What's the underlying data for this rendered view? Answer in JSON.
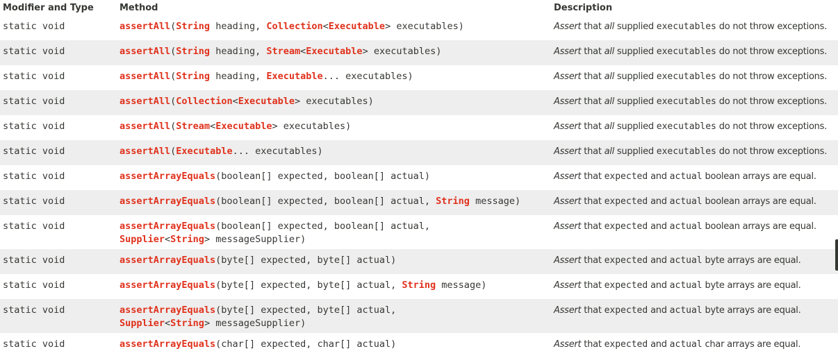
{
  "headers": {
    "modifier": "Modifier and Type",
    "method": "Method",
    "description": "Description"
  },
  "rows": [
    {
      "modifier": "static void",
      "name": "assertAll",
      "args": [
        "(",
        {
          "t": "String"
        },
        " heading, ",
        {
          "t": "Collection"
        },
        "<",
        {
          "t": "Executable"
        },
        "> executables)"
      ],
      "desc": [
        {
          "i": "Assert"
        },
        " that ",
        {
          "i": "all"
        },
        " supplied ",
        {
          "c": "executables"
        },
        " do not throw exceptions."
      ]
    },
    {
      "modifier": "static void",
      "name": "assertAll",
      "args": [
        "(",
        {
          "t": "String"
        },
        " heading, ",
        {
          "t": "Stream"
        },
        "<",
        {
          "t": "Executable"
        },
        "> executables)"
      ],
      "desc": [
        {
          "i": "Assert"
        },
        " that ",
        {
          "i": "all"
        },
        " supplied ",
        {
          "c": "executables"
        },
        " do not throw exceptions."
      ]
    },
    {
      "modifier": "static void",
      "name": "assertAll",
      "args": [
        "(",
        {
          "t": "String"
        },
        " heading, ",
        {
          "t": "Executable"
        },
        "... executables)"
      ],
      "desc": [
        {
          "i": "Assert"
        },
        " that ",
        {
          "i": "all"
        },
        " supplied ",
        {
          "c": "executables"
        },
        " do not throw exceptions."
      ]
    },
    {
      "modifier": "static void",
      "name": "assertAll",
      "args": [
        "(",
        {
          "t": "Collection"
        },
        "<",
        {
          "t": "Executable"
        },
        "> executables)"
      ],
      "desc": [
        {
          "i": "Assert"
        },
        " that ",
        {
          "i": "all"
        },
        " supplied ",
        {
          "c": "executables"
        },
        " do not throw exceptions."
      ]
    },
    {
      "modifier": "static void",
      "name": "assertAll",
      "args": [
        "(",
        {
          "t": "Stream"
        },
        "<",
        {
          "t": "Executable"
        },
        "> executables)"
      ],
      "desc": [
        {
          "i": "Assert"
        },
        " that ",
        {
          "i": "all"
        },
        " supplied ",
        {
          "c": "executables"
        },
        " do not throw exceptions."
      ]
    },
    {
      "modifier": "static void",
      "name": "assertAll",
      "args": [
        "(",
        {
          "t": "Executable"
        },
        "... executables)"
      ],
      "desc": [
        {
          "i": "Assert"
        },
        " that ",
        {
          "i": "all"
        },
        " supplied ",
        {
          "c": "executables"
        },
        " do not throw exceptions."
      ]
    },
    {
      "modifier": "static void",
      "name": "assertArrayEquals",
      "args": [
        "(boolean[] expected, boolean[] actual)"
      ],
      "desc": [
        {
          "i": "Assert"
        },
        " that ",
        {
          "c": "expected"
        },
        " and ",
        {
          "c": "actual"
        },
        " boolean arrays are equal."
      ]
    },
    {
      "modifier": "static void",
      "name": "assertArrayEquals",
      "args": [
        "(boolean[] expected, boolean[] actual, ",
        {
          "t": "String"
        },
        " message)"
      ],
      "desc": [
        {
          "i": "Assert"
        },
        " that ",
        {
          "c": "expected"
        },
        " and ",
        {
          "c": "actual"
        },
        " boolean arrays are equal."
      ]
    },
    {
      "modifier": "static void",
      "name": "assertArrayEquals",
      "args": [
        "(boolean[] expected, boolean[] actual,",
        {
          "br": true
        },
        {
          "t": "Supplier"
        },
        "<",
        {
          "t": "String"
        },
        "> messageSupplier)"
      ],
      "desc": [
        {
          "i": "Assert"
        },
        " that ",
        {
          "c": "expected"
        },
        " and ",
        {
          "c": "actual"
        },
        " boolean arrays are equal."
      ]
    },
    {
      "modifier": "static void",
      "name": "assertArrayEquals",
      "args": [
        "(byte[] expected, byte[] actual)"
      ],
      "desc": [
        {
          "i": "Assert"
        },
        " that ",
        {
          "c": "expected"
        },
        " and ",
        {
          "c": "actual"
        },
        " byte arrays are equal."
      ]
    },
    {
      "modifier": "static void",
      "name": "assertArrayEquals",
      "args": [
        "(byte[] expected, byte[] actual, ",
        {
          "t": "String"
        },
        " message)"
      ],
      "desc": [
        {
          "i": "Assert"
        },
        " that ",
        {
          "c": "expected"
        },
        " and ",
        {
          "c": "actual"
        },
        " byte arrays are equal."
      ]
    },
    {
      "modifier": "static void",
      "name": "assertArrayEquals",
      "args": [
        "(byte[] expected, byte[] actual,",
        {
          "br": true
        },
        {
          "t": "Supplier"
        },
        "<",
        {
          "t": "String"
        },
        "> messageSupplier)"
      ],
      "desc": [
        {
          "i": "Assert"
        },
        " that ",
        {
          "c": "expected"
        },
        " and ",
        {
          "c": "actual"
        },
        " byte arrays are equal."
      ]
    },
    {
      "modifier": "static void",
      "name": "assertArrayEquals",
      "args": [
        "(char[] expected, char[] actual)"
      ],
      "desc": [
        {
          "i": "Assert"
        },
        " that ",
        {
          "c": "expected"
        },
        " and ",
        {
          "c": "actual"
        },
        " char arrays are equal."
      ]
    }
  ],
  "colors": {
    "link": "#e0311c",
    "text": "#353833",
    "alt_row": "#eeeeee"
  }
}
